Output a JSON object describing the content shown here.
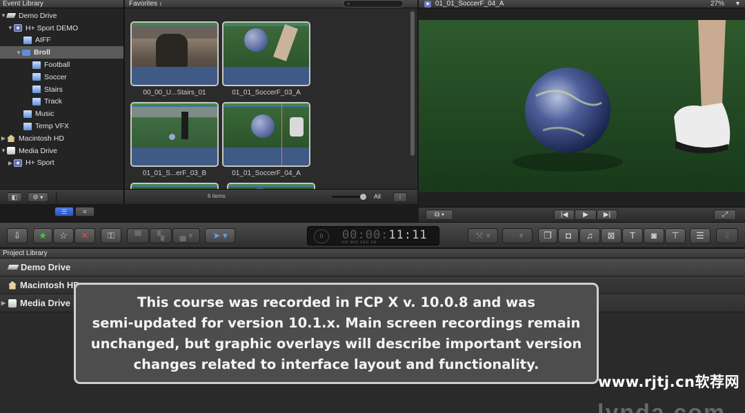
{
  "event_library": {
    "title": "Event Library",
    "items": [
      {
        "label": "Demo Drive",
        "icon": "drive-icon"
      },
      {
        "label": "H+ Sport DEMO",
        "icon": "library-star-icon"
      },
      {
        "label": "AIFF",
        "icon": "event-icon"
      },
      {
        "label": "Broll",
        "icon": "folder-icon",
        "selected": true
      },
      {
        "label": "Football",
        "icon": "event-icon"
      },
      {
        "label": "Soccer",
        "icon": "event-icon"
      },
      {
        "label": "Stairs",
        "icon": "event-icon"
      },
      {
        "label": "Track",
        "icon": "event-icon"
      },
      {
        "label": "Music",
        "icon": "event-icon"
      },
      {
        "label": "Temp VFX",
        "icon": "event-icon"
      },
      {
        "label": "Macintosh HD",
        "icon": "house-icon"
      },
      {
        "label": "Media Drive",
        "icon": "drive-icon"
      },
      {
        "label": "H+ Sport",
        "icon": "library-star-icon"
      }
    ]
  },
  "browser": {
    "filter_label": "Favorites",
    "sort_arrow": "↕",
    "search_icon": "⌕",
    "clips": [
      {
        "name": "00_00_U...Stairs_01"
      },
      {
        "name": "01_01_SoccerF_03_A"
      },
      {
        "name": "01_01_S...erF_03_B"
      },
      {
        "name": "01_01_SoccerF_04_A"
      },
      {
        "name": ""
      },
      {
        "name": ""
      }
    ],
    "item_count": "6 items",
    "filter_all": "All"
  },
  "viewer": {
    "clip_title": "01_01_SoccerF_04_A",
    "zoom": "27%",
    "star": "★"
  },
  "toolbar": {
    "timecode": {
      "dim": "00:00:",
      "lit": "11:11",
      "units": "HR    MIN    SEC    FR",
      "circle": "0"
    }
  },
  "project_library": {
    "title": "Project Library",
    "rows": [
      {
        "label": "Demo Drive"
      },
      {
        "label": "Macintosh HD"
      },
      {
        "label": "Media Drive"
      }
    ]
  },
  "overlay": {
    "lines": [
      "This course was recorded in FCP X v. 10.0.8 and was",
      "semi-updated for version 10.1.x.  Main screen recordings remain",
      "unchanged, but graphic overlays will describe important version",
      "changes related to interface layout and functionality."
    ]
  },
  "watermark": "www.rjtj.cn软荐网",
  "logo": "lynda.com",
  "colors": {
    "accent_blue": "#2955c4",
    "reject_red": "#e84848",
    "favorite_green": "#3ccf3c",
    "skimmer": "#ff6464"
  }
}
